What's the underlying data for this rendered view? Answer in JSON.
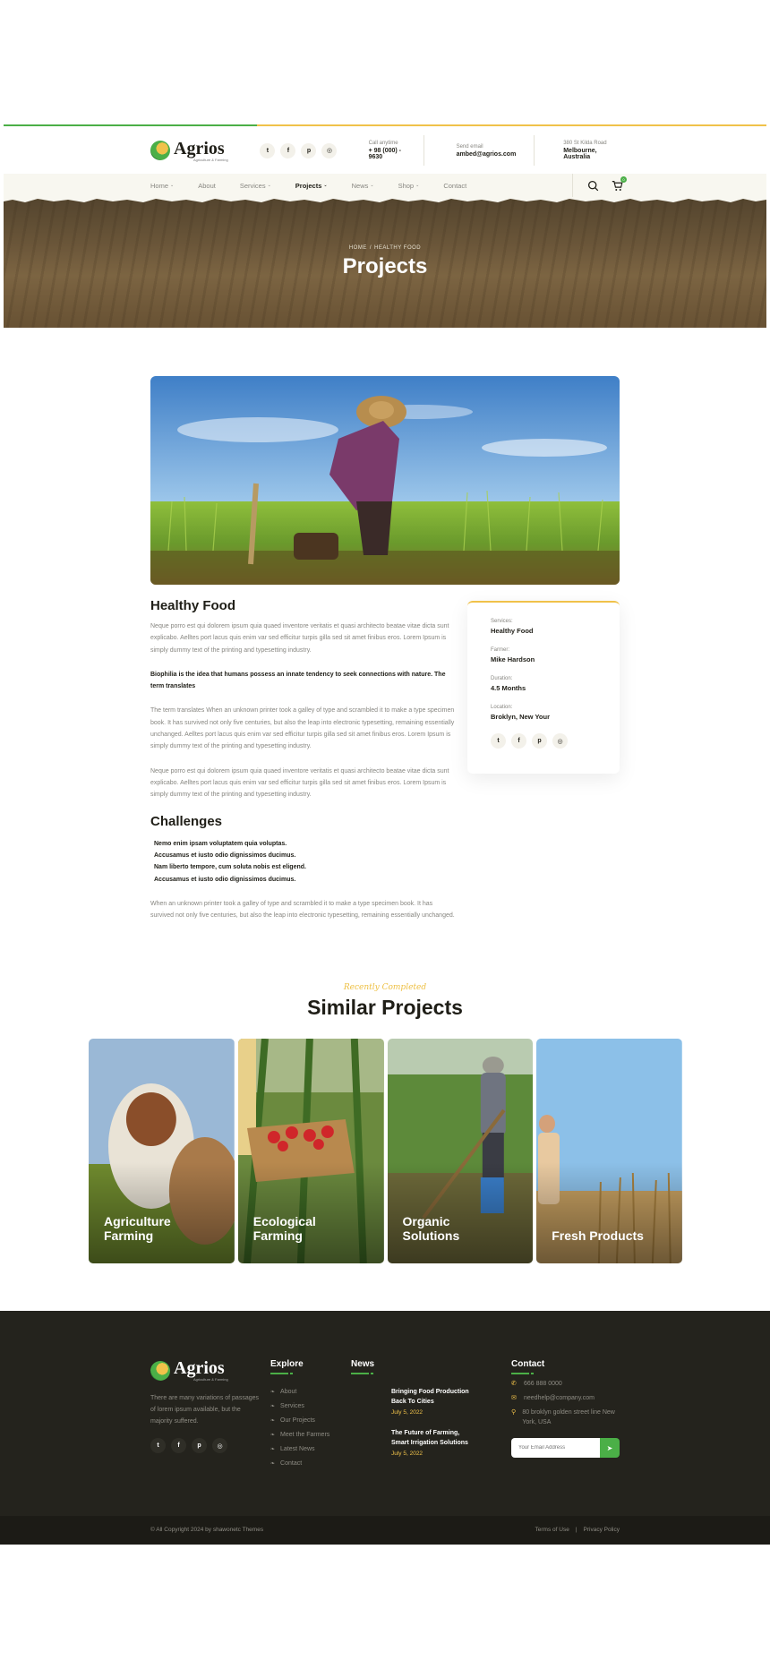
{
  "brand": {
    "name": "Agrios",
    "tagline": "Agriculture & Farming"
  },
  "header": {
    "call_label": "Call anytime",
    "call_value": "+ 98 (000) - 9630",
    "email_label": "Send email",
    "email_value": "ambed@agrios.com",
    "address_label": "380 St Kilda Road",
    "address_value": "Melbourne, Australia"
  },
  "nav": {
    "items": [
      "Home",
      "About",
      "Services",
      "Projects",
      "News",
      "Shop",
      "Contact"
    ],
    "active": "Projects",
    "cart_count": "0"
  },
  "hero": {
    "crumb_home": "HOME",
    "crumb_sep": "/",
    "crumb_current": "HEALTHY FOOD",
    "title": "Projects"
  },
  "project": {
    "title": "Healthy Food",
    "p1": "Neque porro est qui dolorem ipsum quia quaed inventore veritatis et quasi architecto beatae vitae dicta sunt explicabo. Aelltes port lacus quis enim var sed efficitur turpis gilla sed sit amet finibus eros. Lorem Ipsum is simply dummy text of the printing and typesetting industry.",
    "p2": "Biophilia is the idea that humans possess an innate tendency to seek connections with nature. The term translates",
    "p3": "The term translates When an unknown printer took a galley of type and scrambled it to make a type specimen book. It has survived not only five centuries, but also the leap into electronic typesetting, remaining essentially unchanged. Aelltes port lacus quis enim var sed efficitur turpis gilla sed sit amet finibus eros. Lorem Ipsum is simply dummy text of the printing and typesetting industry.",
    "p4": "Neque porro est qui dolorem ipsum quia quaed inventore veritatis et quasi architecto beatae vitae dicta sunt explicabo. Aelltes port lacus quis enim var sed efficitur turpis gilla sed sit amet finibus eros. Lorem Ipsum is simply dummy text of the printing and typesetting industry.",
    "challenges_title": "Challenges",
    "challenges": [
      "Nemo enim ipsam voluptatem quia voluptas.",
      "Accusamus et iusto odio dignissimos ducimus.",
      "Nam liberto tempore, cum soluta nobis est eligend.",
      "Accusamus et iusto odio dignissimos ducimus."
    ],
    "p5": "When an unknown printer took a galley of type and scrambled it to make a type specimen book. It has survived not only five centuries, but also the leap into electronic typesetting, remaining essentially unchanged."
  },
  "info_card": {
    "services_label": "Services:",
    "services_value": "Healthy Food",
    "farmer_label": "Farmer:",
    "farmer_value": "Mike Hardson",
    "duration_label": "Duration:",
    "duration_value": "4.5 Months",
    "location_label": "Location:",
    "location_value": "Broklyn, New Your"
  },
  "similar": {
    "tagline": "Recently Completed",
    "title": "Similar Projects",
    "items": [
      "Agriculture Farming",
      "Ecological Farming",
      "Organic Solutions",
      "Fresh Products"
    ]
  },
  "footer": {
    "about": "There are many variations of passages of lorem ipsum available, but the majority suffered.",
    "explore_title": "Explore",
    "explore_links": [
      "About",
      "Services",
      "Our Projects",
      "Meet the Farmers",
      "Latest News",
      "Contact"
    ],
    "news_title": "News",
    "news": [
      {
        "title": "Bringing Food Production Back To Cities",
        "date": "July 5, 2022"
      },
      {
        "title": "The Future of Farming, Smart Irrigation Solutions",
        "date": "July 5, 2022"
      }
    ],
    "contact_title": "Contact",
    "phone": "666 888 0000",
    "email": "needhelp@company.com",
    "address": "80 broklyn golden street line New York, USA",
    "email_placeholder": "Your Email Address"
  },
  "bottom": {
    "copyright": "© All Copyright 2024 by shawonetc Themes",
    "terms": "Terms of Use",
    "sep": "|",
    "privacy": "Privacy Policy"
  },
  "colors": {
    "green": "#4baf47",
    "yellow": "#f0c24a",
    "dark": "#24231d"
  }
}
